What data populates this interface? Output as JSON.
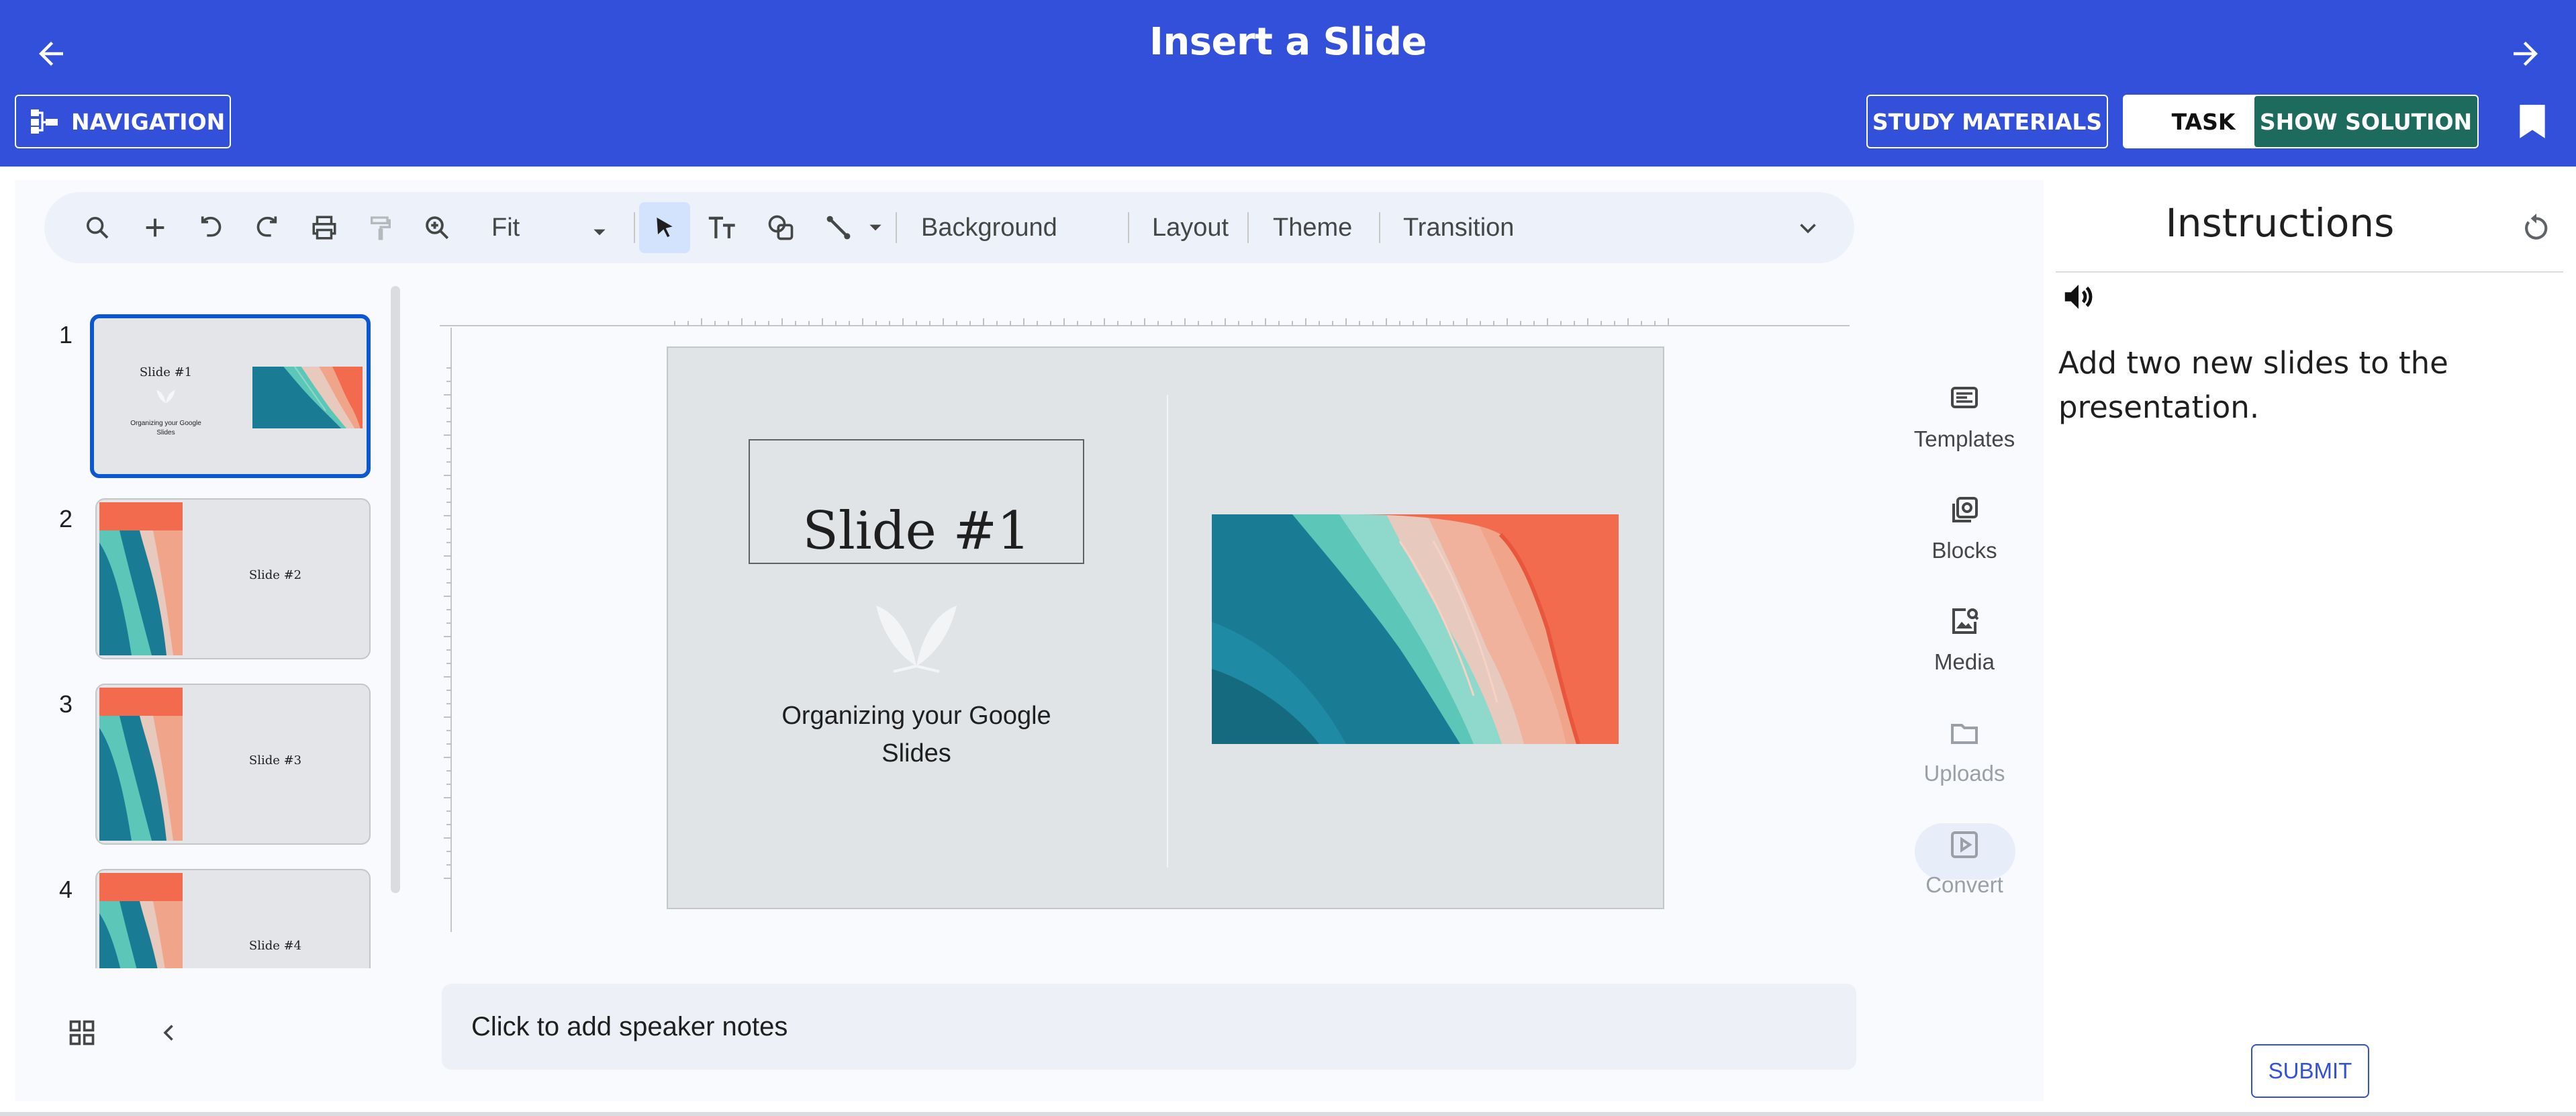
{
  "header": {
    "title": "Insert a Slide",
    "navigation_label": "NAVIGATION",
    "study_materials_label": "STUDY MATERIALS",
    "task_label": "TASK",
    "show_solution_label": "SHOW SOLUTION"
  },
  "toolbar": {
    "zoom_value": "Fit",
    "background_label": "Background",
    "layout_label": "Layout",
    "theme_label": "Theme",
    "transition_label": "Transition"
  },
  "thumbnails": [
    {
      "number": "1",
      "title": "Slide #1",
      "subtitle": "Organizing your Google Slides",
      "selected": true
    },
    {
      "number": "2",
      "title": "Slide #2",
      "selected": false
    },
    {
      "number": "3",
      "title": "Slide #3",
      "selected": false
    },
    {
      "number": "4",
      "title": "Slide #4",
      "selected": false
    }
  ],
  "slide": {
    "title": "Slide #1",
    "subtitle": "Organizing your Google Slides"
  },
  "side_tools": [
    {
      "label": "Templates",
      "icon": "templates-icon",
      "enabled": true
    },
    {
      "label": "Blocks",
      "icon": "blocks-icon",
      "enabled": true
    },
    {
      "label": "Media",
      "icon": "media-icon",
      "enabled": true
    },
    {
      "label": "Uploads",
      "icon": "folder-icon",
      "enabled": false
    },
    {
      "label": "Convert",
      "icon": "convert-icon",
      "enabled": false
    }
  ],
  "notes": {
    "placeholder": "Click to add speaker notes"
  },
  "instructions": {
    "title": "Instructions",
    "text": "Add two new slides to the presentation.",
    "submit_label": "SUBMIT"
  },
  "colors": {
    "header_bg": "#3350db",
    "solution_bg": "#1d6b5d",
    "selection": "#0b57d0",
    "wave_teal": "#1a7c94",
    "wave_mint": "#5cc7b8",
    "wave_coral": "#f26b4f"
  }
}
